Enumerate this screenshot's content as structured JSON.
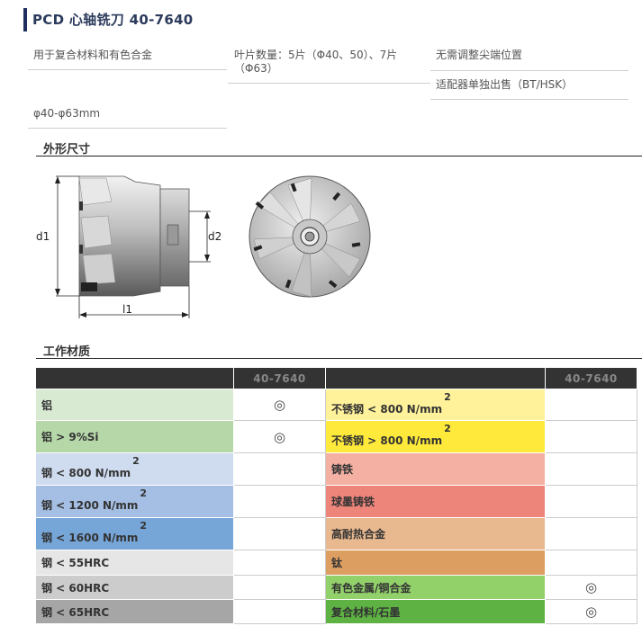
{
  "header": {
    "title": "PCD 心轴铣刀 40-7640"
  },
  "features": {
    "col1": [
      "用于复合材料和有色合金",
      "φ40-φ63mm"
    ],
    "col2": "叶片数量：5片（Φ40、50）、7片（Φ63）",
    "col2_line1": "叶片数量：5片（Φ40、50）、7片",
    "col2_line2": "（Φ63）",
    "col3": [
      "无需调整尖端位置",
      "适配器单独出售（BT/HSK）"
    ]
  },
  "sections": {
    "dimensions": "外形尺寸",
    "materials": "工作材质"
  },
  "drawing": {
    "d1": "d1",
    "d2": "d2",
    "l1": "l1"
  },
  "table": {
    "product_header": "40-7640",
    "mark_symbol": "◎",
    "left": [
      {
        "name": "铝",
        "sup": "",
        "color": "#d9ead3",
        "mark": "◎"
      },
      {
        "name": "铝 > 9%Si",
        "sup": "",
        "color": "#b6d7a8",
        "mark": "◎"
      },
      {
        "name": "钢 < 800 N/mm",
        "sup": "2",
        "color": "#cfdcf0",
        "mark": ""
      },
      {
        "name": "钢 < 1200 N/mm",
        "sup": "2",
        "color": "#a4bfe3",
        "mark": ""
      },
      {
        "name": "钢 < 1600 N/mm",
        "sup": "2",
        "color": "#76a5d8",
        "mark": ""
      },
      {
        "name": "钢 < 55HRC",
        "sup": "",
        "color": "#e6e6e6",
        "mark": ""
      },
      {
        "name": "钢 < 60HRC",
        "sup": "",
        "color": "#cccccc",
        "mark": ""
      },
      {
        "name": "钢 < 65HRC",
        "sup": "",
        "color": "#a6a6a6",
        "mark": ""
      }
    ],
    "right": [
      {
        "name": "不锈钢 < 800 N/mm",
        "sup": "2",
        "color": "#fff29a",
        "mark": ""
      },
      {
        "name": "不锈钢 > 800 N/mm",
        "sup": "2",
        "color": "#ffea3b",
        "mark": ""
      },
      {
        "name": "铸铁",
        "sup": "",
        "color": "#f4b0a2",
        "mark": ""
      },
      {
        "name": "球墨铸铁",
        "sup": "",
        "color": "#ee857a",
        "mark": ""
      },
      {
        "name": "高耐热合金",
        "sup": "",
        "color": "#e8b88f",
        "mark": ""
      },
      {
        "name": "钛",
        "sup": "",
        "color": "#dd9e62",
        "mark": ""
      },
      {
        "name": "有色金属/铜合金",
        "sup": "",
        "color": "#92d06a",
        "mark": "◎"
      },
      {
        "name": "复合材料/石墨",
        "sup": "",
        "color": "#5eb243",
        "mark": "◎"
      }
    ]
  }
}
